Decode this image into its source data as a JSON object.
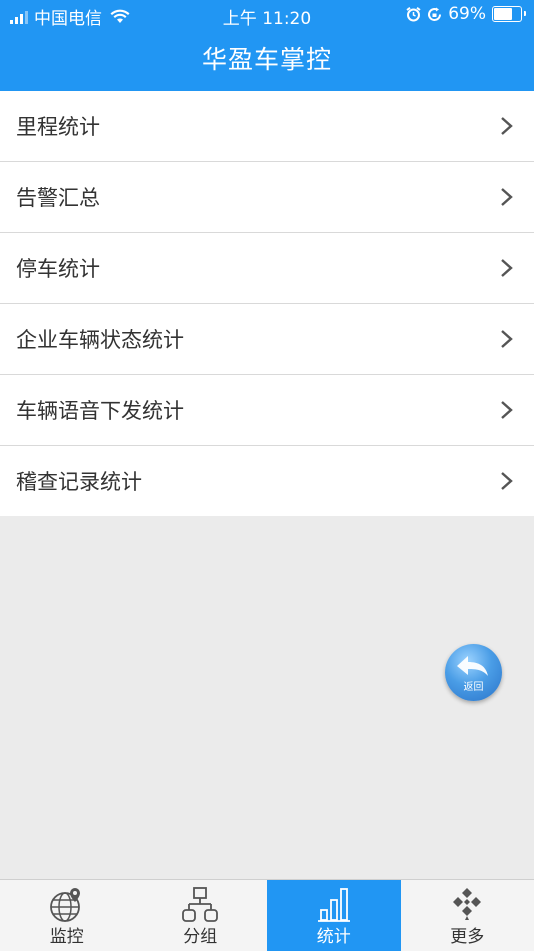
{
  "status_bar": {
    "carrier": "中国电信",
    "time": "上午 11:20",
    "battery_percent": "69%",
    "battery_level": 0.69
  },
  "header": {
    "title": "华盈车掌控"
  },
  "menu": {
    "items": [
      {
        "label": "里程统计"
      },
      {
        "label": "告警汇总"
      },
      {
        "label": "停车统计"
      },
      {
        "label": "企业车辆状态统计"
      },
      {
        "label": "车辆语音下发统计"
      },
      {
        "label": "稽查记录统计"
      }
    ]
  },
  "back_button": {
    "label": "返回"
  },
  "tabs": [
    {
      "label": "监控",
      "icon": "globe-pin-icon",
      "active": false
    },
    {
      "label": "分组",
      "icon": "group-tree-icon",
      "active": false
    },
    {
      "label": "统计",
      "icon": "bar-chart-icon",
      "active": true
    },
    {
      "label": "更多",
      "icon": "more-diamonds-icon",
      "active": false
    }
  ],
  "colors": {
    "primary": "#2196f3",
    "background": "#ebebeb",
    "text": "#333333"
  }
}
